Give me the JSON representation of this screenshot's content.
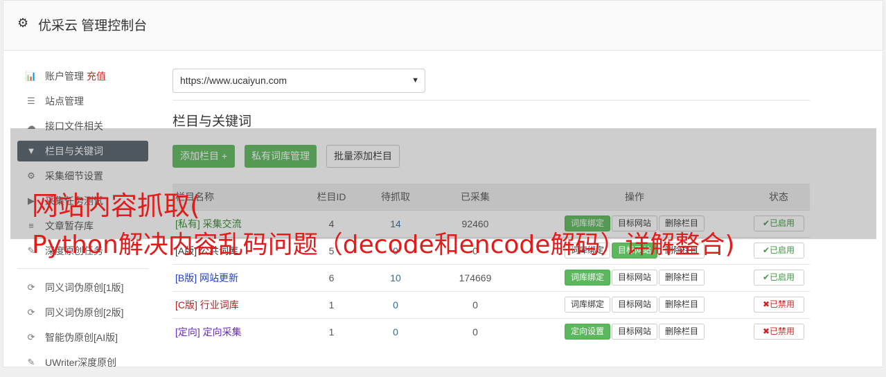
{
  "header": {
    "title": "优采云 管理控制台",
    "icon": "gear-icon"
  },
  "sidebar": {
    "items": [
      {
        "label": "账户管理",
        "extra": "充值",
        "icon": "bar-chart-icon"
      },
      {
        "label": "站点管理",
        "icon": "server-icon"
      },
      {
        "label": "接口文件相关",
        "icon": "cloud-upload-icon"
      },
      {
        "label": "栏目与关键词",
        "icon": "filter-icon",
        "active": true
      },
      {
        "label": "采集细节设置",
        "icon": "cogs-icon"
      },
      {
        "label": "采集任务测试",
        "icon": "play-icon"
      },
      {
        "label": "文章暂存库",
        "icon": "database-icon"
      },
      {
        "label": "深度原创任务",
        "icon": "edit-icon"
      }
    ],
    "items2": [
      {
        "label": "同义词伪原创[1版]",
        "icon": "refresh-icon"
      },
      {
        "label": "同义词伪原创[2版]",
        "icon": "refresh-icon"
      },
      {
        "label": "智能伪原创[AI版]",
        "icon": "refresh-icon"
      },
      {
        "label": "UWriter深度原创",
        "icon": "edit-icon"
      }
    ]
  },
  "main": {
    "site_select": "https://www.ucaiyun.com",
    "section_title": "栏目与关键词",
    "buttons": {
      "add": "添加栏目 +",
      "private": "私有词库管理",
      "batch": "批量添加栏目"
    },
    "table": {
      "headers": [
        "栏目名称",
        "栏目ID",
        "待抓取",
        "已采集",
        "操作",
        "状态"
      ],
      "rows": [
        {
          "name": "[私有] 采集交流",
          "id": "4",
          "pending": "14",
          "collected": "92460",
          "op1": "词库绑定",
          "op2": "目标网站",
          "op3": "删除栏目",
          "status": "已启用",
          "color": "green"
        },
        {
          "name": "[A版] 公共词库",
          "id": "5",
          "pending": "0",
          "collected": "0",
          "op1": "词库绑定",
          "op2": "目标网站",
          "op3": "删除栏目",
          "status": "已启用",
          "color": "black"
        },
        {
          "name": "[B版] 网站更新",
          "id": "6",
          "pending": "10",
          "collected": "174669",
          "op1": "词库绑定",
          "op2": "目标网站",
          "op3": "删除栏目",
          "status": "已启用",
          "color": "blue"
        },
        {
          "name": "[C版] 行业词库",
          "id": "1",
          "pending": "0",
          "collected": "0",
          "op1": "词库绑定",
          "op2": "目标网站",
          "op3": "删除栏目",
          "status": "已禁用",
          "color": "red"
        },
        {
          "name": "[定向] 定向采集",
          "id": "1",
          "pending": "0",
          "collected": "0",
          "op1": "定向设置",
          "op2": "目标网站",
          "op3": "删除栏目",
          "status": "已禁用",
          "color": "purple"
        }
      ]
    }
  },
  "overlay": {
    "line1": "网站内容抓取(",
    "line2": "Python解决内容乱码问题（decode和encode解码）详解整合)"
  }
}
